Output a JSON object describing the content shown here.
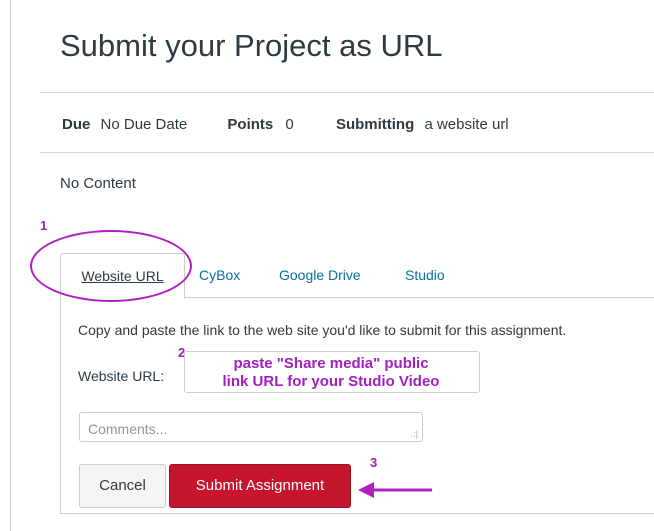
{
  "page": {
    "title": "Submit your Project as URL",
    "no_content": "No Content"
  },
  "meta": {
    "due_label": "Due",
    "due_value": "No Due Date",
    "points_label": "Points",
    "points_value": "0",
    "submitting_label": "Submitting",
    "submitting_value": "a website url"
  },
  "tabs": [
    {
      "label": "Website URL",
      "active": true
    },
    {
      "label": "CyBox"
    },
    {
      "label": "Google Drive"
    },
    {
      "label": "Studio"
    }
  ],
  "form": {
    "instructions": "Copy and paste the link to the web site you'd like to submit for this assignment.",
    "url_label": "Website URL:",
    "url_hint_line1": "paste \"Share media\" public",
    "url_hint_line2": "link URL for your Studio Video",
    "comments_placeholder": "Comments...",
    "cancel_label": "Cancel",
    "submit_label": "Submit Assignment"
  },
  "annotations": {
    "step1": "1",
    "step2": "2",
    "step3": "3",
    "color": "#a020c0"
  }
}
